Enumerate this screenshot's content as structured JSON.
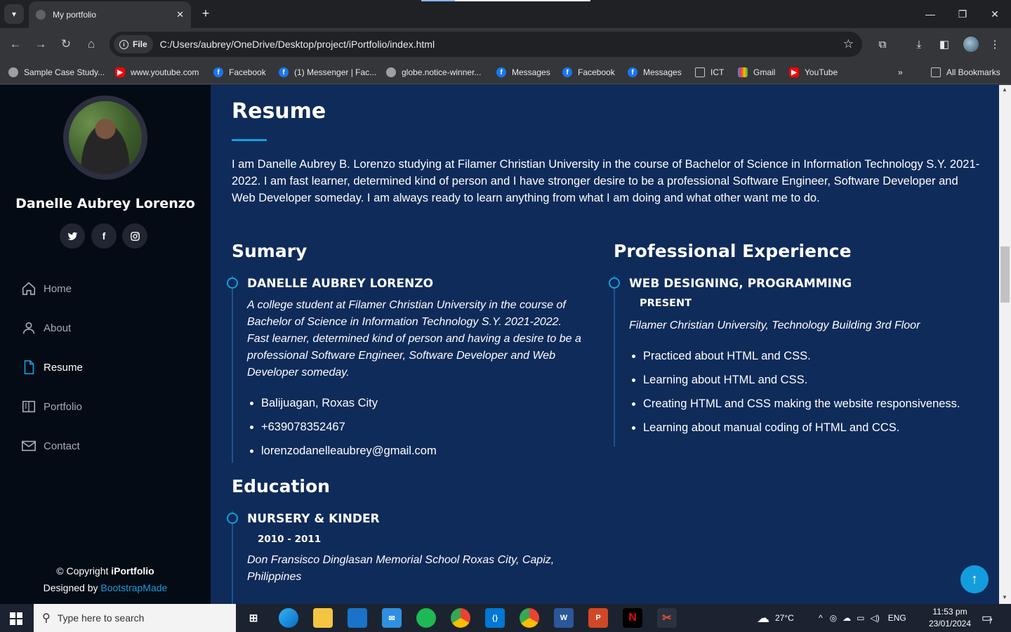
{
  "browser": {
    "tab_title": "My portfolio",
    "url_chip": "File",
    "url": "C:/Users/aubrey/OneDrive/Desktop/project/iPortfolio/index.html",
    "bookmarks": [
      {
        "label": "Sample Case Study...",
        "icon": "globe-icon"
      },
      {
        "label": "www.youtube.com",
        "icon": "youtube-icon"
      },
      {
        "label": "Facebook",
        "icon": "facebook-icon"
      },
      {
        "label": "(1) Messenger | Fac...",
        "icon": "facebook-icon"
      },
      {
        "label": "globe.notice-winner...",
        "icon": "globe-icon"
      },
      {
        "label": "Messages",
        "icon": "facebook-icon"
      },
      {
        "label": "Facebook",
        "icon": "facebook-icon"
      },
      {
        "label": "Messages",
        "icon": "facebook-icon"
      },
      {
        "label": "ICT",
        "icon": "folder-icon"
      },
      {
        "label": "Gmail",
        "icon": "gmail-icon"
      },
      {
        "label": "YouTube",
        "icon": "youtube-icon"
      }
    ],
    "all_bookmarks": "All Bookmarks",
    "more_bookmarks": "»"
  },
  "sidebar": {
    "name": "Danelle Aubrey Lorenzo",
    "social": [
      "twitter-icon",
      "facebook-icon",
      "instagram-icon"
    ],
    "nav": [
      {
        "label": "Home",
        "icon": "home-icon"
      },
      {
        "label": "About",
        "icon": "person-icon"
      },
      {
        "label": "Resume",
        "icon": "file-icon",
        "active": true
      },
      {
        "label": "Portfolio",
        "icon": "book-icon"
      },
      {
        "label": "Contact",
        "icon": "envelope-icon"
      }
    ],
    "footer": {
      "copyright_prefix": "© Copyright ",
      "brand": "iPortfolio",
      "designed_by": "Designed by ",
      "designer": "BootstrapMade"
    }
  },
  "resume": {
    "title": "Resume",
    "intro": "I am Danelle Aubrey B. Lorenzo studying at Filamer Christian University in the course of Bachelor of Science in Information Technology S.Y. 2021-2022. I am fast learner, determined kind of person and I have stronger desire to be a professional Software Engineer, Software Developer and Web Developer someday. I am always ready to learn anything from what I am doing and what other want me to do.",
    "summary": {
      "title": "Sumary",
      "name": "DANELLE AUBREY LORENZO",
      "description": "A college student at Filamer Christian University in the course of Bachelor of Science in Information Technology S.Y. 2021-2022. Fast learner, determined kind of person and having a desire to be a professional Software Engineer, Software Developer and Web Developer someday.",
      "items": [
        "Balijuagan, Roxas City",
        "+639078352467",
        "lorenzodanelleaubrey@gmail.com"
      ]
    },
    "experience": {
      "title": "Professional Experience",
      "role": "WEB DESIGNING, PROGRAMMING",
      "period": "PRESENT",
      "place": "Filamer Christian University, Technology Building 3rd Floor",
      "items": [
        "Practiced about HTML and CSS.",
        "Learning about HTML and CSS.",
        "Creating HTML and CSS making the website responsiveness.",
        "Learning about manual coding of HTML and CCS."
      ]
    },
    "education": {
      "title": "Education",
      "level": "NURSERY & KINDER",
      "years": "2010 - 2011",
      "school": "Don Fransisco Dinglasan Memorial School Roxas City, Capiz, Philippines"
    }
  },
  "taskbar": {
    "search_placeholder": "Type here to search",
    "weather": "27°C",
    "language": "ENG",
    "time": "11:53 pm",
    "date": "23/01/2024",
    "notification_count": "7"
  },
  "colors": {
    "accent": "#149ddd",
    "sidebar_bg": "#040b14",
    "main_bg": "#0f2b5a"
  }
}
